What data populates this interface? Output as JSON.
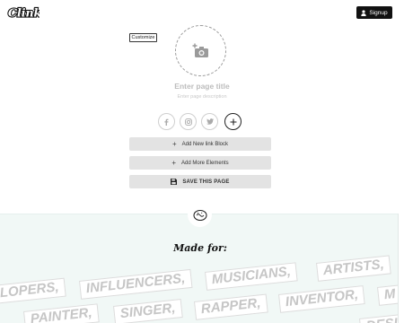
{
  "header": {
    "logo_text": "Clink",
    "signup_label": "Signup"
  },
  "profile": {
    "customize_label": "Customize",
    "title_placeholder": "Enter page title",
    "description_placeholder": "Enter page description"
  },
  "social_icons": [
    "facebook-icon",
    "instagram-icon",
    "twitter-icon",
    "plus-icon"
  ],
  "actions": {
    "add_link": "Add New link Block",
    "add_elements": "Add More Elements",
    "save": "SAVE THIS PAGE"
  },
  "made_for": {
    "heading": "Made for:",
    "row1": [
      "LOPERS,",
      "INFLUENCERS,",
      "MUSICIANS,",
      "ARTISTS,"
    ],
    "row2": [
      "PAINTER,",
      "SINGER,",
      "RAPPER,",
      "INVENTOR,",
      "M"
    ],
    "row3": [
      "DESIG"
    ]
  },
  "colors": {
    "band_background": "#f1f8f6",
    "button_background": "#e3e3e3",
    "signup_background": "#111111"
  }
}
